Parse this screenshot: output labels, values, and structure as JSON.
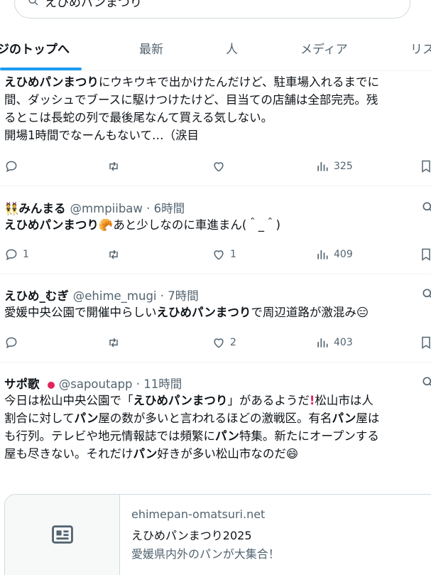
{
  "search": {
    "query": "えひめパンまつり"
  },
  "tabs": [
    {
      "label": "ジのトップへ",
      "active": true
    },
    {
      "label": "最新"
    },
    {
      "label": "人"
    },
    {
      "label": "メディア"
    },
    {
      "label": "リス"
    }
  ],
  "posts": [
    {
      "lines": [
        [
          "えひめパンまつり",
          "にウキウキで出かけたんだけど、駐車場入れるまでに"
        ],
        [
          "",
          "間、ダッシュでブースに駆けつけたけど、目当ての店舗は全部完売。残"
        ],
        [
          "",
          "るとこは長蛇の列で最後尾なんて買える気しない。"
        ],
        [
          "",
          "開場1時間でなーんもないて…（涙目"
        ]
      ],
      "views": "325"
    },
    {
      "author": "みんまる",
      "handle": "@mmpiibaw · 6時間",
      "body_bold": "えひめパンまつり",
      "body_rest": "あと少しなのに車進まん(＾_＾)",
      "replies": "1",
      "likes": "1",
      "views": "409"
    },
    {
      "author": "えひめ_むぎ",
      "handle": "@ehime_mugi · 7時間",
      "body_pre": "愛媛中央公園で開催中らしい",
      "body_bold": "えひめパンまつり",
      "body_post": "で周辺道路が激混み",
      "likes": "2",
      "views": "403"
    },
    {
      "author": "サポ歌",
      "handle": "@sapoutapp · 11時間",
      "l1a": "今日は松山中央公園で「",
      "l1b": "えひめパンまつり",
      "l1c": "」があるようだ",
      "l1d": "松山市は人",
      "l2a": "割合に対して",
      "l2b": "パン",
      "l2c": "屋の数が多いと言われるほどの激戦区。有名",
      "l2d": "パン",
      "l2e": "屋は",
      "l3a": "も行列。テレビや地元情報誌では頻繁に",
      "l3b": "パン",
      "l3c": "特集。新たにオープンする",
      "l4a": "屋も尽きない。それだけ",
      "l4b": "パン",
      "l4c": "好きが多い松山市なのだ"
    }
  ],
  "link_card": {
    "domain": "ehimepan-omatsuri.net",
    "title": "えひめパンまつり2025",
    "description": "愛媛県内外のパンが大集合！"
  },
  "colors": {
    "accent": "#1d9bf0",
    "muted": "#536471",
    "text": "#0f1419"
  }
}
